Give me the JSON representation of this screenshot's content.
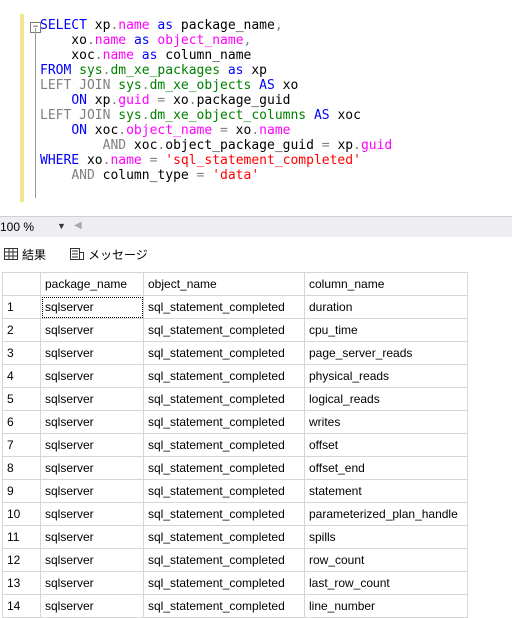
{
  "editor": {
    "lines": [
      [
        {
          "t": "SELECT",
          "c": "kw"
        },
        {
          "t": " xp"
        },
        {
          "t": ".",
          "c": "op"
        },
        {
          "t": "name",
          "c": "mg"
        },
        {
          "t": " "
        },
        {
          "t": "as",
          "c": "kw"
        },
        {
          "t": " package_name"
        },
        {
          "t": ",",
          "c": "op"
        }
      ],
      [
        {
          "t": "    xo"
        },
        {
          "t": ".",
          "c": "op"
        },
        {
          "t": "name",
          "c": "mg"
        },
        {
          "t": " "
        },
        {
          "t": "as",
          "c": "kw"
        },
        {
          "t": " "
        },
        {
          "t": "object_name",
          "c": "mg"
        },
        {
          "t": ",",
          "c": "op"
        }
      ],
      [
        {
          "t": "    xoc"
        },
        {
          "t": ".",
          "c": "op"
        },
        {
          "t": "name",
          "c": "mg"
        },
        {
          "t": " "
        },
        {
          "t": "as",
          "c": "kw"
        },
        {
          "t": " column_name"
        }
      ],
      [
        {
          "t": "FROM",
          "c": "kw"
        },
        {
          "t": " "
        },
        {
          "t": "sys",
          "c": "fn"
        },
        {
          "t": ".",
          "c": "op"
        },
        {
          "t": "dm_xe_packages",
          "c": "fn"
        },
        {
          "t": " "
        },
        {
          "t": "as",
          "c": "kw"
        },
        {
          "t": " xp"
        }
      ],
      [
        {
          "t": "LEFT JOIN",
          "c": "op"
        },
        {
          "t": " "
        },
        {
          "t": "sys",
          "c": "fn"
        },
        {
          "t": ".",
          "c": "op"
        },
        {
          "t": "dm_xe_objects",
          "c": "fn"
        },
        {
          "t": " "
        },
        {
          "t": "AS",
          "c": "kw"
        },
        {
          "t": " xo"
        }
      ],
      [
        {
          "t": "    "
        },
        {
          "t": "ON",
          "c": "kw"
        },
        {
          "t": " xp"
        },
        {
          "t": ".",
          "c": "op"
        },
        {
          "t": "guid",
          "c": "mg"
        },
        {
          "t": " "
        },
        {
          "t": "=",
          "c": "op"
        },
        {
          "t": " xo"
        },
        {
          "t": ".",
          "c": "op"
        },
        {
          "t": "package_guid"
        }
      ],
      [
        {
          "t": "LEFT JOIN",
          "c": "op"
        },
        {
          "t": " "
        },
        {
          "t": "sys",
          "c": "fn"
        },
        {
          "t": ".",
          "c": "op"
        },
        {
          "t": "dm_xe_object_columns",
          "c": "fn"
        },
        {
          "t": " "
        },
        {
          "t": "AS",
          "c": "kw"
        },
        {
          "t": " xoc"
        }
      ],
      [
        {
          "t": "    "
        },
        {
          "t": "ON",
          "c": "kw"
        },
        {
          "t": " xoc"
        },
        {
          "t": ".",
          "c": "op"
        },
        {
          "t": "object_name",
          "c": "mg"
        },
        {
          "t": " "
        },
        {
          "t": "=",
          "c": "op"
        },
        {
          "t": " xo"
        },
        {
          "t": ".",
          "c": "op"
        },
        {
          "t": "name",
          "c": "mg"
        }
      ],
      [
        {
          "t": "        "
        },
        {
          "t": "AND",
          "c": "op"
        },
        {
          "t": " xoc"
        },
        {
          "t": ".",
          "c": "op"
        },
        {
          "t": "object_package_guid"
        },
        {
          "t": " "
        },
        {
          "t": "=",
          "c": "op"
        },
        {
          "t": " xp"
        },
        {
          "t": ".",
          "c": "op"
        },
        {
          "t": "guid",
          "c": "mg"
        }
      ],
      [
        {
          "t": "WHERE",
          "c": "kw"
        },
        {
          "t": " xo"
        },
        {
          "t": ".",
          "c": "op"
        },
        {
          "t": "name",
          "c": "mg"
        },
        {
          "t": " "
        },
        {
          "t": "=",
          "c": "op"
        },
        {
          "t": " "
        },
        {
          "t": "'sql_statement_completed'",
          "c": "str"
        }
      ],
      [
        {
          "t": "    "
        },
        {
          "t": "AND",
          "c": "op"
        },
        {
          "t": " column_type "
        },
        {
          "t": "=",
          "c": "op"
        },
        {
          "t": " "
        },
        {
          "t": "'data'",
          "c": "str"
        }
      ]
    ]
  },
  "status": {
    "zoom": "100 %"
  },
  "tabs": {
    "results": "結果",
    "messages": "メッセージ"
  },
  "grid": {
    "columns": [
      "package_name",
      "object_name",
      "column_name"
    ],
    "rows": [
      [
        "1",
        "sqlserver",
        "sql_statement_completed",
        "duration"
      ],
      [
        "2",
        "sqlserver",
        "sql_statement_completed",
        "cpu_time"
      ],
      [
        "3",
        "sqlserver",
        "sql_statement_completed",
        "page_server_reads"
      ],
      [
        "4",
        "sqlserver",
        "sql_statement_completed",
        "physical_reads"
      ],
      [
        "5",
        "sqlserver",
        "sql_statement_completed",
        "logical_reads"
      ],
      [
        "6",
        "sqlserver",
        "sql_statement_completed",
        "writes"
      ],
      [
        "7",
        "sqlserver",
        "sql_statement_completed",
        "offset"
      ],
      [
        "8",
        "sqlserver",
        "sql_statement_completed",
        "offset_end"
      ],
      [
        "9",
        "sqlserver",
        "sql_statement_completed",
        "statement"
      ],
      [
        "10",
        "sqlserver",
        "sql_statement_completed",
        "parameterized_plan_handle"
      ],
      [
        "11",
        "sqlserver",
        "sql_statement_completed",
        "spills"
      ],
      [
        "12",
        "sqlserver",
        "sql_statement_completed",
        "row_count"
      ],
      [
        "13",
        "sqlserver",
        "sql_statement_completed",
        "last_row_count"
      ],
      [
        "14",
        "sqlserver",
        "sql_statement_completed",
        "line_number"
      ]
    ]
  },
  "colors": {
    "keyword": "#0000ff",
    "system_object": "#008000",
    "string": "#ff0000",
    "column_ref": "#ff00ff",
    "operator": "#808080"
  }
}
